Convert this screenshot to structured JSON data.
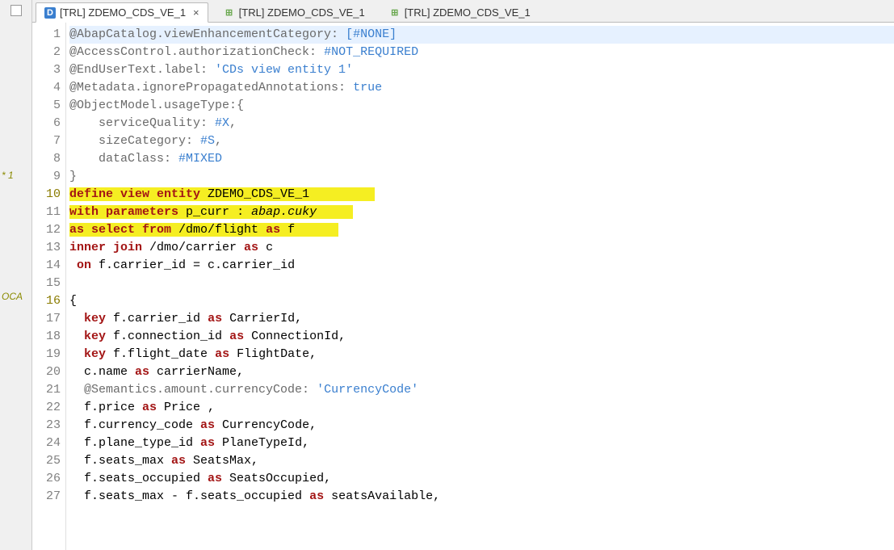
{
  "sidebar": {
    "label1": "* 1",
    "label2": "OCA"
  },
  "tabs": [
    {
      "label": "[TRL] ZDEMO_CDS_VE_1",
      "active": true,
      "icon": "D",
      "showClose": true
    },
    {
      "label": "[TRL] ZDEMO_CDS_VE_1",
      "active": false,
      "icon": "⊞",
      "showClose": false
    },
    {
      "label": "[TRL] ZDEMO_CDS_VE_1",
      "active": false,
      "icon": "⊞",
      "showClose": false
    }
  ],
  "code": {
    "lines": [
      {
        "n": "1",
        "hl": "blue",
        "html": "<span class='c-anno'>@AbapCatalog.viewEnhancementCategory: </span><span class='c-anno-val'>[#NONE]</span>"
      },
      {
        "n": "2",
        "html": "<span class='c-anno'>@AccessControl.authorizationCheck: </span><span class='c-anno-val'>#NOT_REQUIRED</span>"
      },
      {
        "n": "3",
        "html": "<span class='c-anno'>@EndUserText.label: </span><span class='c-str'>'CDs view entity 1'</span>"
      },
      {
        "n": "4",
        "html": "<span class='c-anno'>@Metadata.ignorePropagatedAnnotations: </span><span class='c-anno-val'>true</span>"
      },
      {
        "n": "5",
        "html": "<span class='c-anno'>@ObjectModel.usageType:{</span>"
      },
      {
        "n": "6",
        "html": "<span class='c-anno'>    serviceQuality: </span><span class='c-anno-val'>#X</span><span class='c-anno'>,</span>"
      },
      {
        "n": "7",
        "html": "<span class='c-anno'>    sizeCategory: </span><span class='c-anno-val'>#S</span><span class='c-anno'>,</span>"
      },
      {
        "n": "8",
        "html": "<span class='c-anno'>    dataClass: </span><span class='c-anno-val'>#MIXED</span>"
      },
      {
        "n": "9",
        "html": "<span class='c-anno'>}</span>"
      },
      {
        "n": "10",
        "marker": true,
        "html": "<span class='hl-yellow'><span class='c-kw'>define view entity</span> <span class='c-ent'>ZDEMO_CDS_VE_1</span>         </span>"
      },
      {
        "n": "11",
        "html": "<span class='hl-yellow'><span class='c-kw'>with parameters</span> <span class='c-ent'>p_curr</span> : <span class='c-type'>abap.cuky</span>     </span>"
      },
      {
        "n": "12",
        "html": "<span class='hl-yellow'><span class='c-kw'>as select from</span> /dmo/flight <span class='c-kw'>as</span> f      </span>"
      },
      {
        "n": "13",
        "html": "<span class='c-kw'>inner join</span> /dmo/carrier <span class='c-kw'>as</span> c"
      },
      {
        "n": "14",
        "html": " <span class='c-kw'>on</span> f.carrier_id = c.carrier_id"
      },
      {
        "n": "15",
        "html": ""
      },
      {
        "n": "16",
        "marker": true,
        "html": "{"
      },
      {
        "n": "17",
        "html": "  <span class='c-kw'>key</span> f.carrier_id <span class='c-kw'>as</span> CarrierId,"
      },
      {
        "n": "18",
        "html": "  <span class='c-kw'>key</span> f.connection_id <span class='c-kw'>as</span> ConnectionId,"
      },
      {
        "n": "19",
        "html": "  <span class='c-kw'>key</span> f.flight_date <span class='c-kw'>as</span> FlightDate,"
      },
      {
        "n": "20",
        "html": "  c.name <span class='c-kw'>as</span> carrierName,"
      },
      {
        "n": "21",
        "html": "  <span class='c-anno'>@Semantics.amount.currencyCode: </span><span class='c-str'>'CurrencyCode'</span>"
      },
      {
        "n": "22",
        "html": "  f.price <span class='c-kw'>as</span> Price ,"
      },
      {
        "n": "23",
        "html": "  f.currency_code <span class='c-kw'>as</span> CurrencyCode,"
      },
      {
        "n": "24",
        "html": "  f.plane_type_id <span class='c-kw'>as</span> PlaneTypeId,"
      },
      {
        "n": "25",
        "html": "  f.seats_max <span class='c-kw'>as</span> SeatsMax,"
      },
      {
        "n": "26",
        "html": "  f.seats_occupied <span class='c-kw'>as</span> SeatsOccupied,"
      },
      {
        "n": "27",
        "html": "  f.seats_max - f.seats_occupied <span class='c-kw'>as</span> seatsAvailable,"
      }
    ]
  }
}
